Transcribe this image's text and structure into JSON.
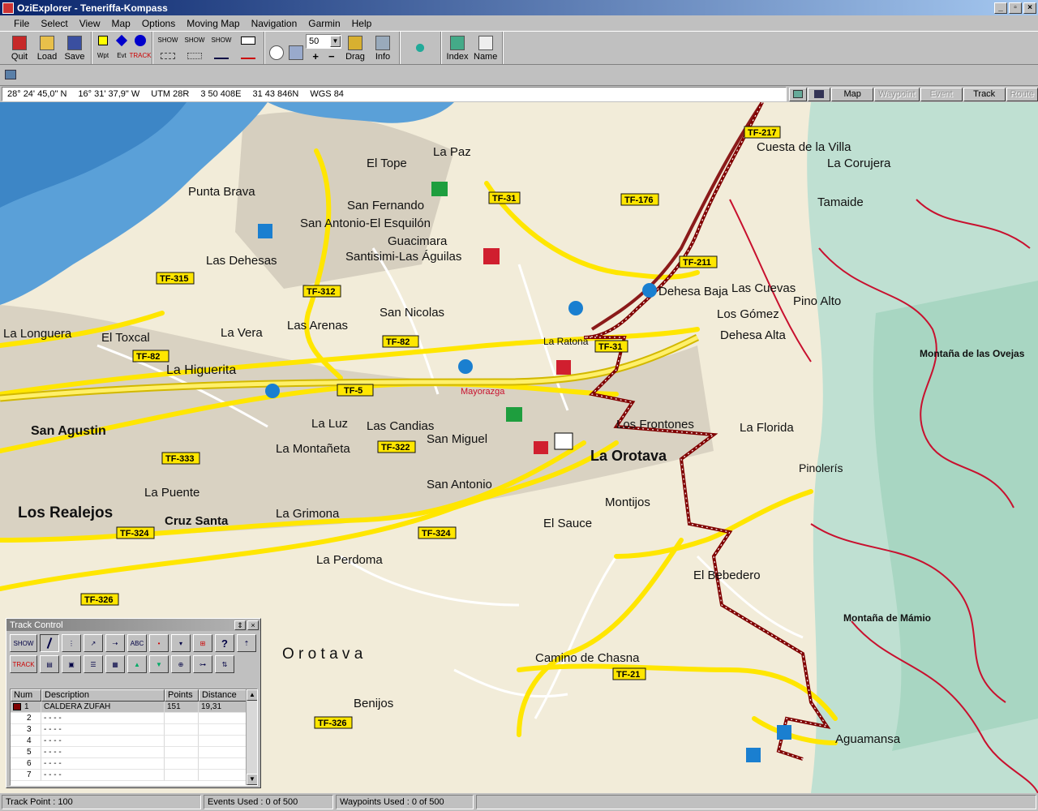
{
  "window": {
    "title": "OziExplorer - Teneriffa-Kompass",
    "minimize": "_",
    "maximize": "▫",
    "close": "×"
  },
  "menu": [
    "File",
    "Select",
    "View",
    "Map",
    "Options",
    "Moving Map",
    "Navigation",
    "Garmin",
    "Help"
  ],
  "toolbar": {
    "quit": "Quit",
    "load": "Load",
    "save": "Save",
    "wpt": "Wpt",
    "evt": "Evt",
    "trk": "TRACK",
    "show": "SHOW",
    "zoom_value": "50",
    "plus": "+",
    "minus": "−",
    "drag": "Drag",
    "info": "Info",
    "index": "Index",
    "name": "Name"
  },
  "coords": {
    "lat": "28° 24' 45,0\" N",
    "lon": "16° 31' 37,9\" W",
    "utm": "UTM  28R",
    "east": "3 50 408E",
    "north": "31 43 846N",
    "datum": "WGS 84"
  },
  "map_tabs": {
    "map": "Map",
    "waypoint": "Waypoint",
    "event": "Event",
    "track": "Track",
    "route": "Route"
  },
  "map": {
    "places": [
      "La Orotava",
      "Los Realejos",
      "San Agustin",
      "La Longuera",
      "El Toxcal",
      "La Higuerita",
      "Las Arenas",
      "San Nicolas",
      "San Antonio",
      "San Miguel",
      "La Perdoma",
      "Benijos",
      "Camino de Chasna",
      "Aguamansa",
      "Pinolerís",
      "La Florida",
      "Dehesa Baja",
      "Los Gómez",
      "Las Cuevas",
      "Cuesta de la Villa",
      "La Corujera",
      "Tamaide",
      "El Bebedero",
      "Cruz Santa",
      "La Puente",
      "La Vera",
      "La Luz",
      "Las Candias",
      "La Montañeta",
      "La Grimona",
      "Punta Brava",
      "Las Dehesas",
      "San Fernando",
      "Guacimara",
      "El Tope",
      "La Paz",
      "Los Frontones",
      "Montijos",
      "El Sauce",
      "Montaña de las Ovejas",
      "Montaña de Mámio",
      "Pino Alto",
      "Dehesa Alta",
      "San Antonio-El Esquilón",
      "Santisimi-Las Águilas",
      "O r o t a v a",
      "La Ratona",
      "Mayorazga"
    ],
    "roads": [
      "TF-217",
      "TF-31",
      "TF-176",
      "TF-211",
      "TF-315",
      "TF-312",
      "TF-82",
      "TF-82",
      "TF-5",
      "TF-322",
      "TF-333",
      "TF-324",
      "TF-324",
      "TF-326",
      "TF-326",
      "TF-21",
      "TF-31"
    ]
  },
  "track_control": {
    "title": "Track Control",
    "headers": [
      "Num",
      "Description",
      "Points",
      "Distance"
    ],
    "rows": [
      {
        "num": "1",
        "desc": "CALDERA ZUFAH",
        "points": "151",
        "distance": "19,31"
      },
      {
        "num": "2",
        "desc": "- - - -",
        "points": "",
        "distance": ""
      },
      {
        "num": "3",
        "desc": "- - - -",
        "points": "",
        "distance": ""
      },
      {
        "num": "4",
        "desc": "- - - -",
        "points": "",
        "distance": ""
      },
      {
        "num": "5",
        "desc": "- - - -",
        "points": "",
        "distance": ""
      },
      {
        "num": "6",
        "desc": "- - - -",
        "points": "",
        "distance": ""
      },
      {
        "num": "7",
        "desc": "- - - -",
        "points": "",
        "distance": ""
      }
    ],
    "btn_show": "SHOW",
    "btn_track": "TRACK",
    "btn_abc": "ABC",
    "btn_help": "?"
  },
  "status": {
    "track_point": "Track Point : 100",
    "events_used": "Events Used : 0 of 500",
    "waypoints_used": "Waypoints Used : 0 of 500"
  },
  "colors": {
    "title_bar": "#08246b",
    "track": "#800000",
    "road": "#ffe600",
    "sea": "#5aa0d8"
  }
}
